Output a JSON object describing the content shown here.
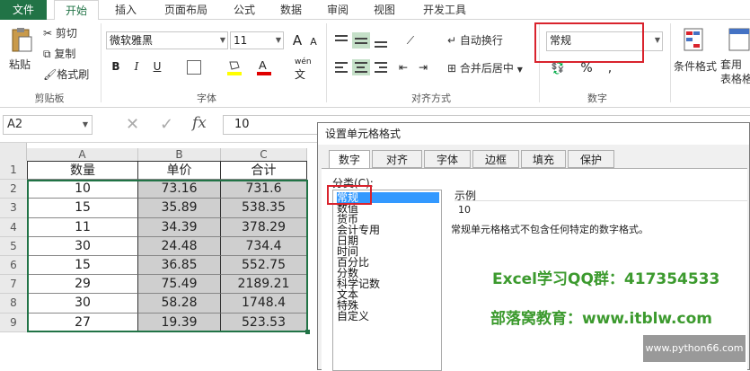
{
  "tabs": {
    "file": "文件",
    "home": "开始",
    "insert": "插入",
    "layout": "页面布局",
    "formula": "公式",
    "data": "数据",
    "review": "审阅",
    "view": "视图",
    "developer": "开发工具"
  },
  "clipboard": {
    "paste": "粘贴",
    "cut": "剪切",
    "copy": "复制",
    "painter": "格式刷",
    "label": "剪贴板"
  },
  "font": {
    "name": "微软雅黑",
    "size": "11",
    "label": "字体",
    "bold": "B",
    "italic": "I",
    "underline": "U",
    "wen": "wén"
  },
  "alignment": {
    "wrap": "自动换行",
    "merge": "合并后居中",
    "label": "对齐方式"
  },
  "number": {
    "format": "常规",
    "percent": "%",
    "label": "数字"
  },
  "styles": {
    "conditional": "条件格式",
    "table_format": "套用\n表格格"
  },
  "formula_bar": {
    "name_box": "A2",
    "fx": "fx",
    "value": "10"
  },
  "sheet": {
    "columns": [
      "A",
      "B",
      "C"
    ],
    "row_numbers": [
      "1",
      "2",
      "3",
      "4",
      "5",
      "6",
      "7",
      "8",
      "9"
    ],
    "header": [
      "数量",
      "单价",
      "合计"
    ],
    "rows": [
      [
        "10",
        "73.16",
        "731.6"
      ],
      [
        "15",
        "35.89",
        "538.35"
      ],
      [
        "11",
        "34.39",
        "378.29"
      ],
      [
        "30",
        "24.48",
        "734.4"
      ],
      [
        "15",
        "36.85",
        "552.75"
      ],
      [
        "29",
        "75.49",
        "2189.21"
      ],
      [
        "30",
        "58.28",
        "1748.4"
      ],
      [
        "27",
        "19.39",
        "523.53"
      ]
    ]
  },
  "dialog": {
    "title": "设置单元格格式",
    "tabs": [
      "数字",
      "对齐",
      "字体",
      "边框",
      "填充",
      "保护"
    ],
    "category_label": "分类(C):",
    "categories": [
      "常规",
      "数值",
      "货币",
      "会计专用",
      "日期",
      "时间",
      "百分比",
      "分数",
      "科学记数",
      "文本",
      "特殊",
      "自定义"
    ],
    "sample_label": "示例",
    "sample_value": "10",
    "description": "常规单元格格式不包含任何特定的数字格式。"
  },
  "watermarks": {
    "line1": "Excel学习QQ群：417354533",
    "line2": "部落窝教育：www.itblw.com",
    "site": "www.python66.com"
  },
  "colors": {
    "excel_green": "#217346",
    "highlight_red": "#d9232d",
    "watermark_green": "#3c9a2e",
    "selected_blue": "#3399ff"
  }
}
